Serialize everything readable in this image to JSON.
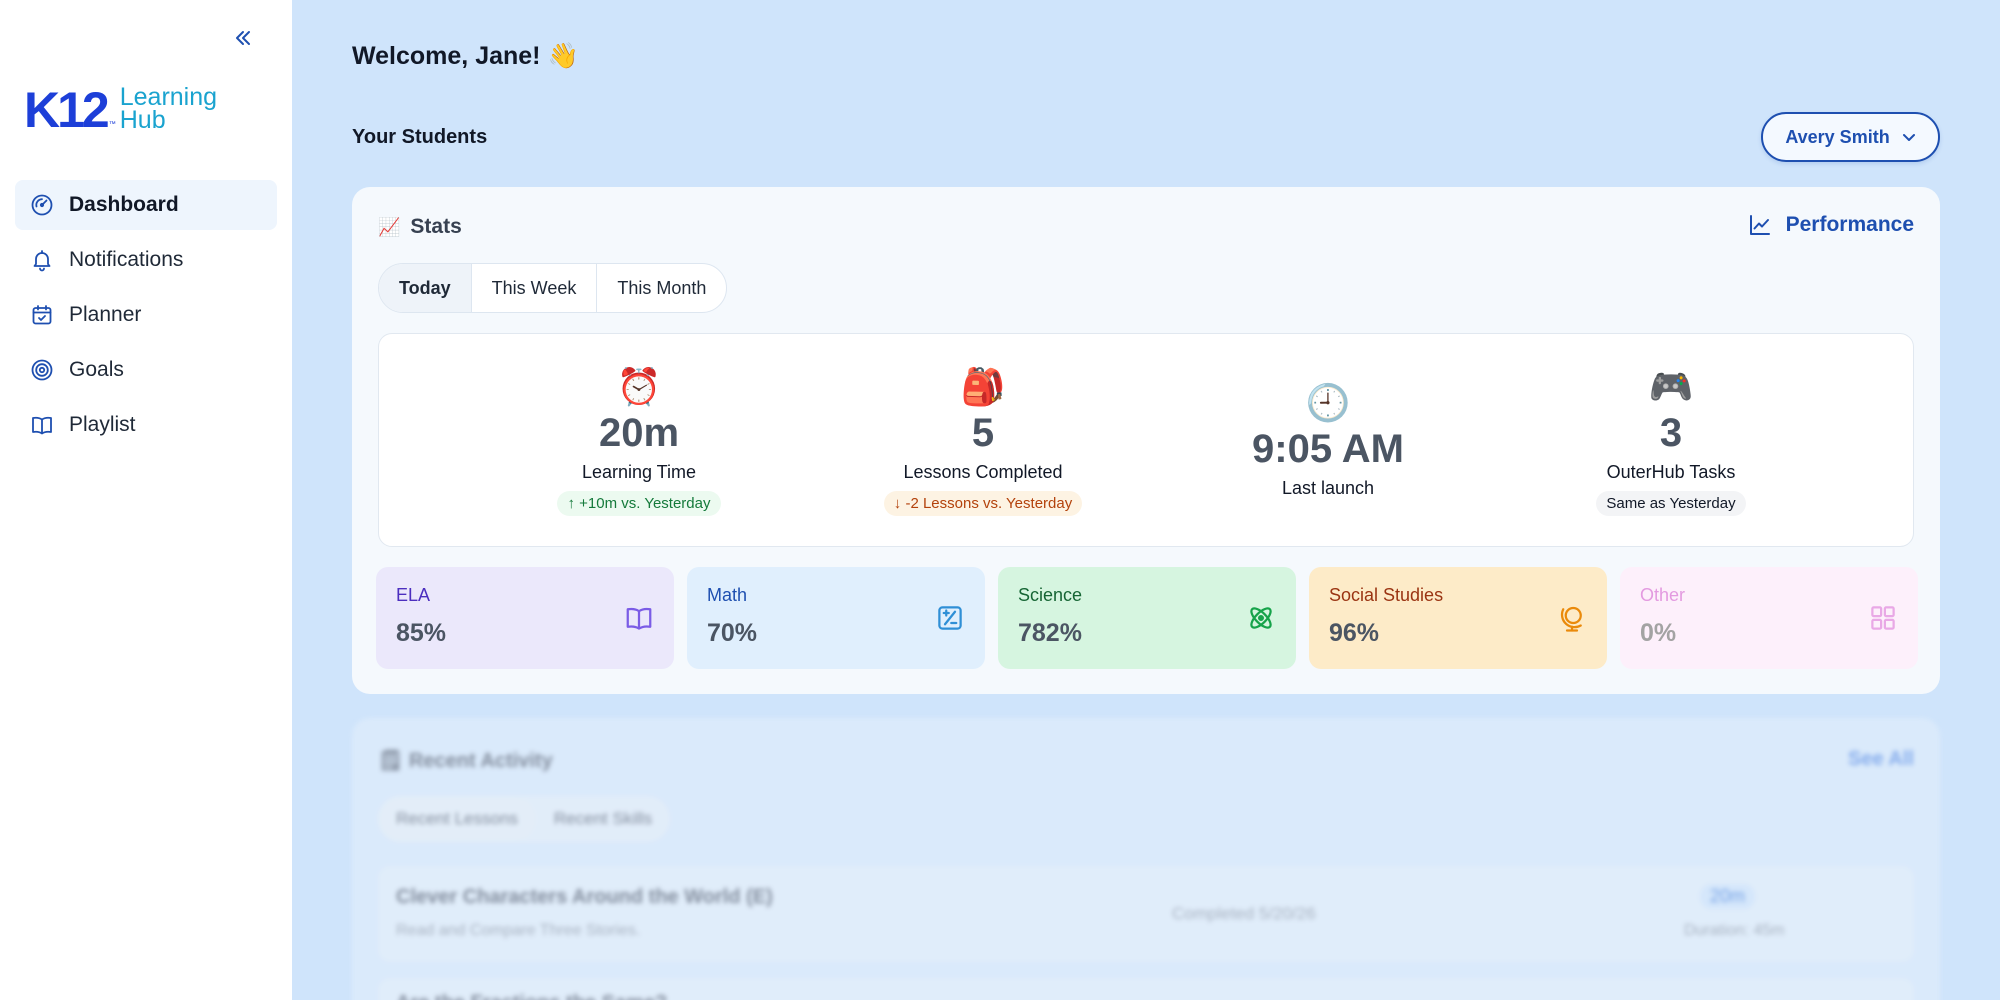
{
  "sidebar": {
    "brand": {
      "k12": "K12",
      "tm": "™",
      "line1": "Learning",
      "line2": "Hub"
    },
    "collapse_icon": "double-chevron-left-icon",
    "items": [
      {
        "label": "Dashboard",
        "icon": "dashboard-gauge-icon",
        "active": true
      },
      {
        "label": "Notifications",
        "icon": "bell-icon"
      },
      {
        "label": "Planner",
        "icon": "calendar-icon"
      },
      {
        "label": "Goals",
        "icon": "target-icon"
      },
      {
        "label": "Playlist",
        "icon": "book-open-icon"
      }
    ]
  },
  "header": {
    "welcome": "Welcome, Jane! 👋",
    "students_label": "Your Students",
    "selected_student": "Avery Smith"
  },
  "stats": {
    "emoji": "📈",
    "title": "Stats",
    "performance_link": "Performance",
    "tabs": [
      {
        "label": "Today",
        "active": true
      },
      {
        "label": "This Week"
      },
      {
        "label": "This Month"
      }
    ],
    "metrics": [
      {
        "emoji": "⏰",
        "value": "20m",
        "label": "Learning Time",
        "badge": "+10m vs. Yesterday",
        "trend": "up"
      },
      {
        "emoji": "🎒",
        "value": "5",
        "label": "Lessons Completed",
        "badge": "-2 Lessons vs. Yesterday",
        "trend": "down"
      },
      {
        "emoji": "🕘",
        "value": "9:05 AM",
        "label": "Last launch"
      },
      {
        "emoji": "🎮",
        "value": "3",
        "label": "OuterHub Tasks",
        "badge": "Same as Yesterday",
        "trend": "same"
      }
    ],
    "subjects": [
      {
        "name": "ELA",
        "value": "85%",
        "bg": "#ebe8fb",
        "color": "#4c2fbf",
        "icon": "book-icon",
        "icon_color": "#7b5ce6"
      },
      {
        "name": "Math",
        "value": "70%",
        "bg": "#e0effd",
        "color": "#1e4fb0",
        "icon": "calculator-icon",
        "icon_color": "#2f8fd6"
      },
      {
        "name": "Science",
        "value": "782%",
        "bg": "#d6f5e0",
        "color": "#166534",
        "icon": "atom-icon",
        "icon_color": "#16a34a"
      },
      {
        "name": "Social Studies",
        "value": "96%",
        "bg": "#fdebc8",
        "color": "#9a3412",
        "icon": "globe-icon",
        "icon_color": "#ea8a0b"
      },
      {
        "name": "Other",
        "value": "0%",
        "bg": "#fdf0fb",
        "color": "#e39ae0",
        "icon": "grid-icon",
        "icon_color": "#e9a8e6",
        "value_color": "#a3a3a3"
      }
    ]
  },
  "recent": {
    "title": "🗒 Recent Activity",
    "see_all": "See All",
    "tabs": [
      "Recent Lessons",
      "Recent Skills"
    ],
    "rows": [
      {
        "title": "Clever Characters Around the World (E)",
        "subtitle": "Read and Compare Three Stories.",
        "status": "Completed 5/20/26",
        "time": "20m",
        "duration": "Duration: 45m"
      },
      {
        "title": "Are the Fractions the Same?"
      }
    ]
  }
}
